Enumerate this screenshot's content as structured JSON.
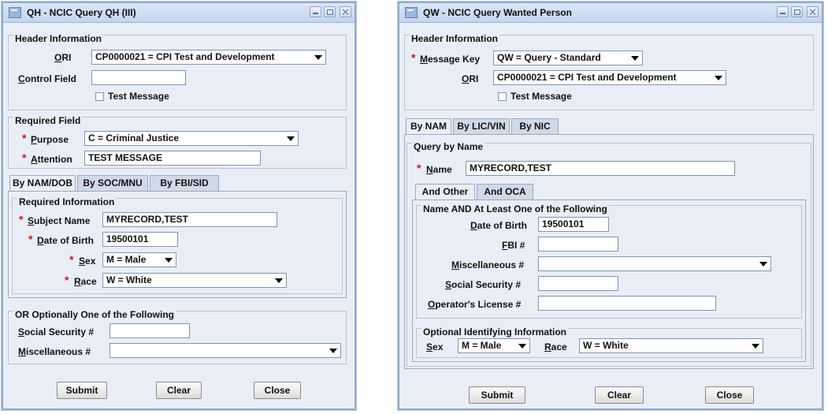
{
  "qh": {
    "title": "QH - NCIC Query QH (III)",
    "header_info": {
      "legend": "Header Information",
      "ori_label": "ORI",
      "ori_value": "CP0000021 = CPI Test and Development",
      "control_field_label": "Control Field",
      "control_field_value": "",
      "test_message_label": "Test Message"
    },
    "required_field": {
      "legend": "Required Field",
      "purpose_label": "Purpose",
      "purpose_value": "C = Criminal Justice",
      "attention_label": "Attention",
      "attention_value": "TEST MESSAGE"
    },
    "tabs": [
      "By NAM/DOB",
      "By SOC/MNU",
      "By FBI/SID"
    ],
    "required_info": {
      "legend": "Required Information",
      "subject_name_label": "Subject Name",
      "subject_name_value": "MYRECORD,TEST",
      "dob_label": "Date of Birth",
      "dob_value": "19500101",
      "sex_label": "Sex",
      "sex_value": "M = Male",
      "race_label": "Race",
      "race_value": "W = White"
    },
    "optional": {
      "legend": "OR Optionally One of the Following",
      "ssn_label": "Social Security #",
      "ssn_value": "",
      "misc_label": "Miscellaneous #",
      "misc_value": ""
    },
    "buttons": {
      "submit": "Submit",
      "clear": "Clear",
      "close": "Close"
    }
  },
  "qw": {
    "title": "QW - NCIC Query Wanted Person",
    "header_info": {
      "legend": "Header Information",
      "message_key_label": "Message Key",
      "message_key_value": "QW = Query - Standard",
      "ori_label": "ORI",
      "ori_value": "CP0000021 = CPI Test and Development",
      "test_message_label": "Test Message"
    },
    "tabs": [
      "By NAM",
      "By LIC/VIN",
      "By NIC"
    ],
    "query_by_name": {
      "legend": "Query by Name",
      "name_label": "Name",
      "name_value": "MYRECORD,TEST",
      "subtabs": [
        "And Other",
        "And OCA"
      ],
      "at_least": {
        "legend": "Name AND At Least One of the Following",
        "dob_label": "Date of Birth",
        "dob_value": "19500101",
        "fbi_label": "FBI #",
        "fbi_value": "",
        "misc_label": "Miscellaneous #",
        "misc_value": "",
        "ssn_label": "Social Security #",
        "ssn_value": "",
        "oln_label": "Operator's License #",
        "oln_value": ""
      },
      "optional_info": {
        "legend": "Optional Identifying Information",
        "sex_label": "Sex",
        "sex_value": "M = Male",
        "race_label": "Race",
        "race_value": "W = White"
      }
    },
    "buttons": {
      "submit": "Submit",
      "clear": "Clear",
      "close": "Close"
    }
  },
  "required_marker": "*"
}
